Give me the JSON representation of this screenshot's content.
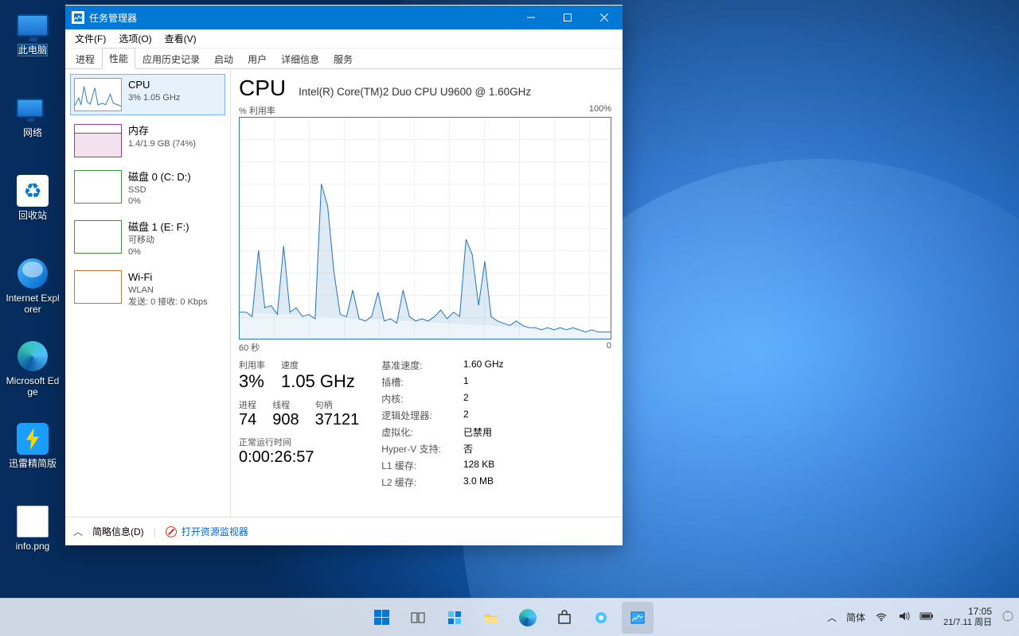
{
  "desktop": {
    "icons": [
      {
        "name": "pc",
        "label": "此电脑"
      },
      {
        "name": "network",
        "label": "网络"
      },
      {
        "name": "recycle",
        "label": "回收站"
      },
      {
        "name": "ie",
        "label": "Internet Explorer"
      },
      {
        "name": "edge",
        "label": "Microsoft Edge"
      },
      {
        "name": "xunlei",
        "label": "迅雷精简版"
      },
      {
        "name": "infopng",
        "label": "info.png"
      }
    ]
  },
  "window": {
    "title": "任务管理器",
    "menu": [
      "文件(F)",
      "选项(O)",
      "查看(V)"
    ],
    "tabs": [
      "进程",
      "性能",
      "应用历史记录",
      "启动",
      "用户",
      "详细信息",
      "服务"
    ],
    "activeTab": "性能"
  },
  "sidebar": {
    "items": [
      {
        "title": "CPU",
        "sub": "3% 1.05 GHz"
      },
      {
        "title": "内存",
        "sub": "1.4/1.9 GB (74%)"
      },
      {
        "title": "磁盘 0 (C: D:)",
        "sub1": "SSD",
        "sub2": "0%"
      },
      {
        "title": "磁盘 1 (E: F:)",
        "sub1": "可移动",
        "sub2": "0%"
      },
      {
        "title": "Wi-Fi",
        "sub1": "WLAN",
        "sub2": "发送: 0 接收: 0 Kbps"
      }
    ]
  },
  "main": {
    "heading": "CPU",
    "subtitle": "Intel(R) Core(TM)2 Duo CPU U9600 @ 1.60GHz",
    "chart_top_left": "% 利用率",
    "chart_top_right": "100%",
    "chart_bottom_left": "60 秒",
    "chart_bottom_right": "0",
    "statsL": {
      "util_k": "利用率",
      "util_v": "3%",
      "speed_k": "速度",
      "speed_v": "1.05 GHz",
      "proc_k": "进程",
      "proc_v": "74",
      "thr_k": "线程",
      "thr_v": "908",
      "hnd_k": "句柄",
      "hnd_v": "37121",
      "uptime_k": "正常运行时间",
      "uptime_v": "0:00:26:57"
    },
    "statsR": [
      {
        "k": "基准速度:",
        "v": "1.60 GHz"
      },
      {
        "k": "插槽:",
        "v": "1"
      },
      {
        "k": "内核:",
        "v": "2"
      },
      {
        "k": "逻辑处理器:",
        "v": "2"
      },
      {
        "k": "虚拟化:",
        "v": "已禁用"
      },
      {
        "k": "Hyper-V 支持:",
        "v": "否"
      },
      {
        "k": "L1 缓存:",
        "v": "128 KB"
      },
      {
        "k": "L2 缓存:",
        "v": "3.0 MB"
      }
    ]
  },
  "footer": {
    "less": "简略信息(D)",
    "resmon": "打开资源监视器"
  },
  "tray": {
    "ime": "简体",
    "time": "17:05",
    "date": "21/7.11 周日"
  },
  "chart_data": {
    "type": "line",
    "title": "% 利用率",
    "ylabel": "% 利用率",
    "ylim": [
      0,
      100
    ],
    "xlabel_left": "60 秒",
    "xlabel_right": "0",
    "values": [
      12,
      12,
      10,
      40,
      14,
      15,
      11,
      42,
      12,
      14,
      10,
      11,
      9,
      70,
      60,
      30,
      11,
      10,
      22,
      9,
      8,
      10,
      21,
      8,
      9,
      7,
      22,
      10,
      8,
      9,
      8,
      10,
      13,
      9,
      12,
      10,
      45,
      38,
      15,
      35,
      10,
      8,
      7,
      6,
      8,
      6,
      5,
      5,
      4,
      5,
      4,
      5,
      4,
      5,
      4,
      3,
      4,
      3,
      3,
      3
    ]
  }
}
